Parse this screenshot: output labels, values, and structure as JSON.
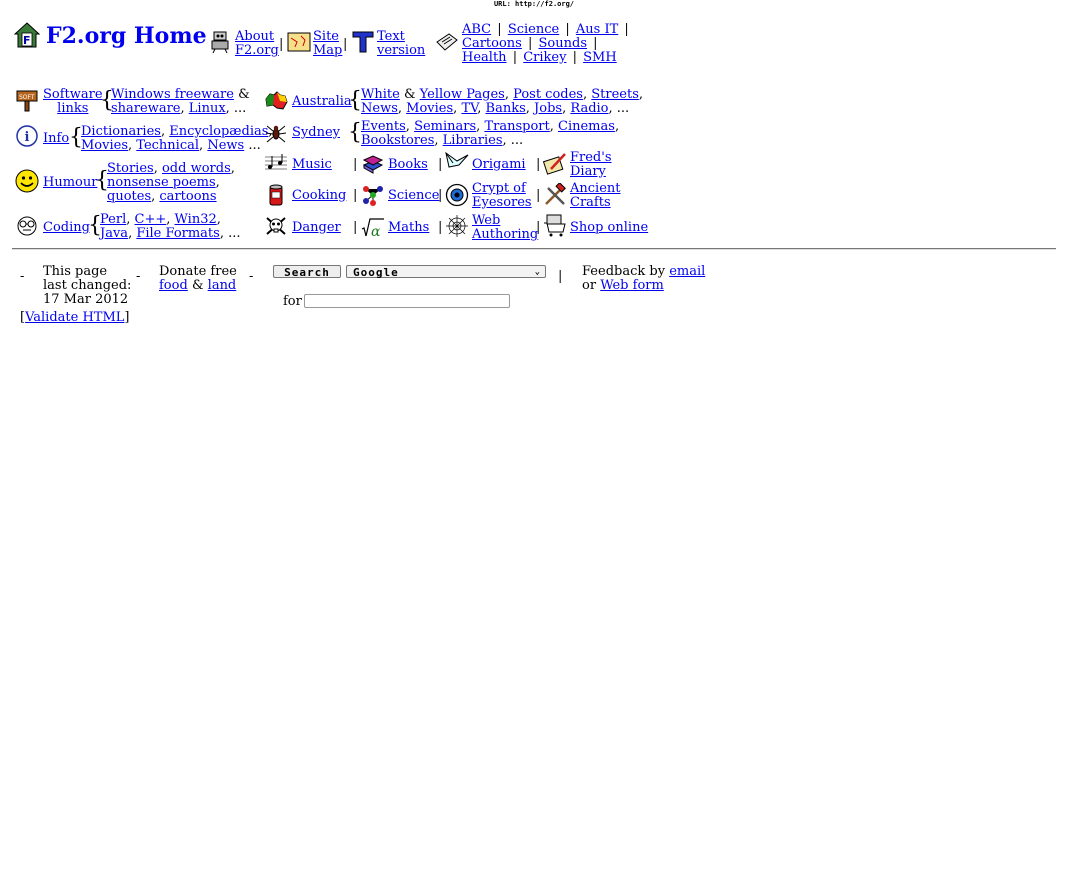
{
  "url_bar": "URL: http://f2.org/",
  "header": {
    "title": "F2.org Home",
    "about": {
      "l1": "About",
      "l2": "F2.org"
    },
    "sitemap": {
      "l1": "Site",
      "l2": "Map"
    },
    "textver": {
      "l1": "Text",
      "l2": "version"
    },
    "news_links": {
      "abc": "ABC",
      "science": "Science",
      "ausit": "Aus IT",
      "cartoons": "Cartoons",
      "sounds": "Sounds",
      "health": "Health",
      "crikey": "Crikey",
      "smh": "SMH"
    },
    "sep": "|"
  },
  "sections": {
    "software": {
      "l1": "Software",
      "l2": "links",
      "windows_freeware": "Windows freeware",
      "amp": "&",
      "shareware": "shareware",
      "linux": "Linux",
      "etc": ", ..."
    },
    "info": {
      "label": "Info",
      "dictionaries": "Dictionaries",
      "encyclopaedias": "Encyclopædias",
      "movies": "Movies",
      "technical": "Technical",
      "news": "News",
      "etc": " ..."
    },
    "humour": {
      "label": "Humour",
      "stories": "Stories",
      "odd_words": "odd words",
      "nonsense_poems": "nonsense poems",
      "quotes": "quotes",
      "cartoons": "cartoons"
    },
    "coding": {
      "label": "Coding",
      "perl": "Perl",
      "cpp": "C++",
      "win32": "Win32",
      "java": "Java",
      "file_formats": "File Formats",
      "etc": ", ..."
    },
    "australia": {
      "label": "Australia",
      "white": "White",
      "amp": "&",
      "yellow": "Yellow Pages",
      "postcodes": "Post codes",
      "streets": "Streets",
      "news": "News",
      "movies": "Movies",
      "tv": "TV",
      "banks": "Banks",
      "jobs": "Jobs",
      "radio": "Radio",
      "etc": ", ..."
    },
    "sydney": {
      "label": "Sydney",
      "events": "Events",
      "seminars": "Seminars",
      "transport": "Transport",
      "cinemas": "Cinemas",
      "bookstores": "Bookstores",
      "libraries": "Libraries",
      "etc": ", ..."
    },
    "music": "Music",
    "books": "Books",
    "origami": "Origami",
    "freds": {
      "l1": "Fred's",
      "l2": "Diary"
    },
    "cooking": "Cooking",
    "science": "Science",
    "crypt": {
      "l1": "Crypt of",
      "l2": "Eyesores"
    },
    "crafts": {
      "l1": "Ancient",
      "l2": "Crafts"
    },
    "danger": "Danger",
    "maths": "Maths",
    "webauth": {
      "l1": "Web",
      "l2": "Authoring"
    },
    "shop": "Shop online",
    "comma": ",",
    "pipe": "|",
    "brace": "{"
  },
  "footer": {
    "dash": "-",
    "changed": {
      "l1": "This page",
      "l2": "last changed:",
      "l3": "17 Mar 2012"
    },
    "validate": "Validate HTML",
    "lb": "[",
    "rb": "]",
    "donate": {
      "l1": "Donate free",
      "food": "food",
      "amp": "&",
      "land": "land"
    },
    "search_button": "Search",
    "engine_selected": "Google",
    "for_label": "for",
    "for_value": "",
    "feedback": {
      "l1": "Feedback by",
      "email": "email",
      "or": "or",
      "webform": "Web form"
    }
  }
}
